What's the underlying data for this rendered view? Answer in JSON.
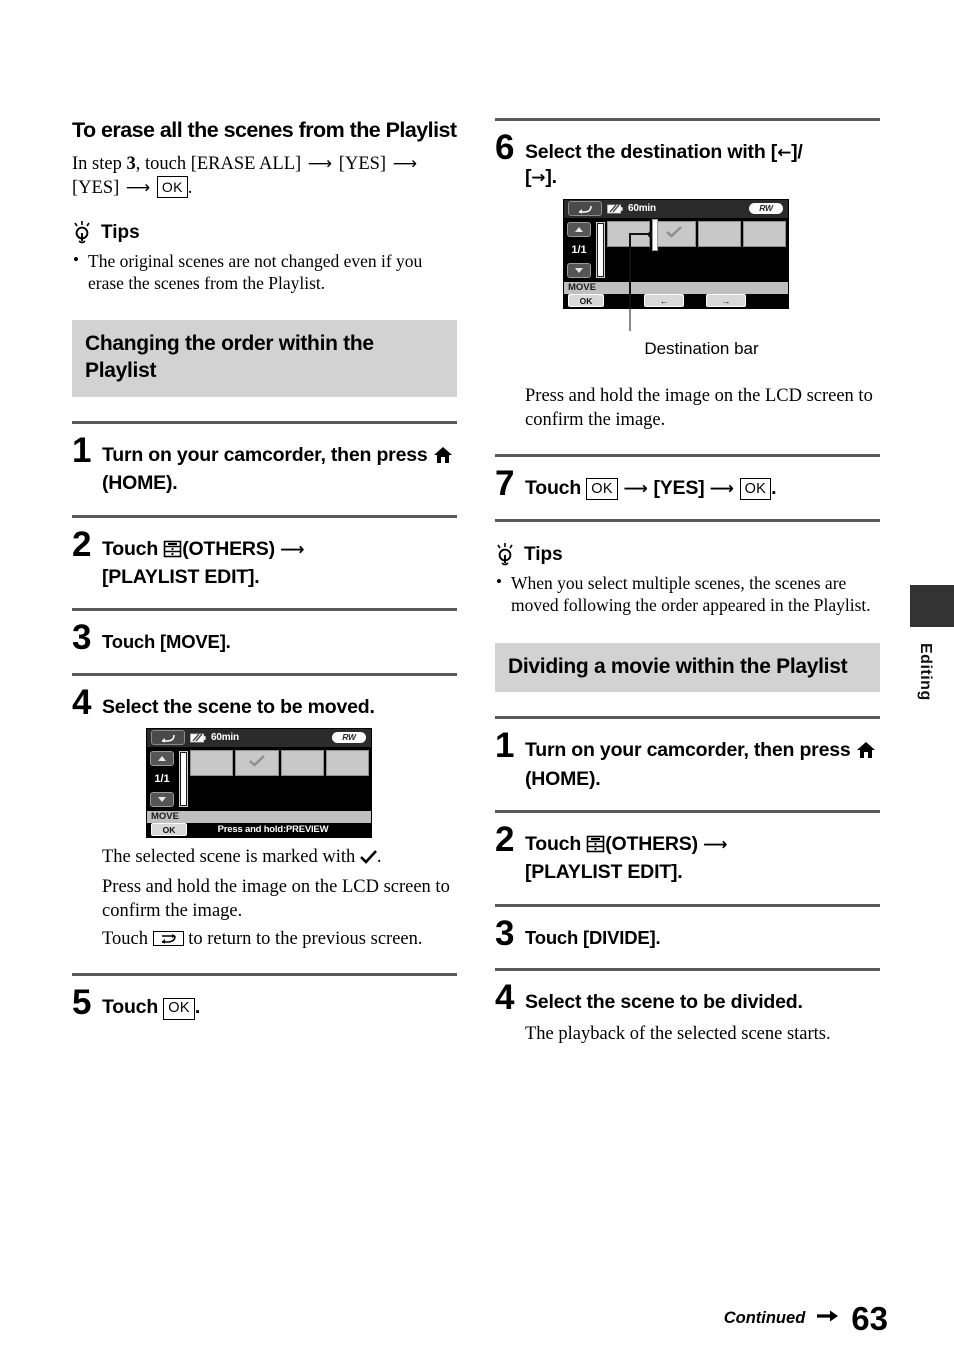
{
  "left_column": {
    "sub_heading": "To erase all the scenes from the Playlist",
    "intro": {
      "part1": "In step ",
      "step_ref": "3",
      "part2": ", touch [ERASE ALL] ",
      "yes1": "[YES] ",
      "yes2": "[YES] ",
      "ok_label": "OK",
      "period": "."
    },
    "tips_label": "Tips",
    "tips": [
      "The original scenes are not changed even if you erase the scenes from the Playlist."
    ],
    "section_title": "Changing the order within the Playlist",
    "steps": [
      {
        "num": "1",
        "text_before": "Turn on your camcorder, then press ",
        "icon": "home-icon",
        "text_after": " (HOME)."
      },
      {
        "num": "2",
        "text_before": "Touch ",
        "icon": "others-icon",
        "text_after": "(OTHERS) ",
        "text_line2": "[PLAYLIST EDIT]."
      },
      {
        "num": "3",
        "text": "Touch [MOVE]."
      },
      {
        "num": "4",
        "text": "Select the scene to be moved."
      },
      {
        "num": "5",
        "text_before": "Touch ",
        "ok_label": "OK",
        "text_after": "."
      }
    ],
    "after_figure": [
      {
        "before": "The selected scene is marked with ",
        "icon": "check-icon",
        "after": "."
      },
      {
        "text": "Press and hold the image on the LCD screen to confirm the image."
      },
      {
        "before": "Touch ",
        "icon": "return-icon",
        "after": " to return to the previous screen."
      }
    ]
  },
  "right_column": {
    "steps": [
      {
        "num": "6",
        "line1": "Select the destination with [",
        "arrow1": "←",
        "line1b": "]/",
        "line2": "[",
        "arrow2": "→",
        "line2b": "]."
      },
      {
        "num": "7",
        "text_before": "Touch ",
        "ok1": "OK",
        "mid": "[YES] ",
        "ok2": "OK",
        "text_after": "."
      },
      {
        "num": "1",
        "text_before": "Turn on your camcorder, then press ",
        "icon": "home-icon",
        "text_after": " (HOME)."
      },
      {
        "num": "2",
        "text_before": "Touch ",
        "icon": "others-icon",
        "text_after": "(OTHERS) ",
        "text_line2": "[PLAYLIST EDIT]."
      },
      {
        "num": "3",
        "text": "Touch [DIVIDE]."
      },
      {
        "num": "4",
        "text": "Select the scene to be divided."
      }
    ],
    "figure_caption": "Destination bar",
    "figure_note": "Press and hold the image on the LCD screen to confirm the image.",
    "tips_label": "Tips",
    "tips": [
      "When you select multiple scenes, the scenes are moved following the order appeared in the Playlist."
    ],
    "section_title": "Dividing a movie within the Playlist",
    "step4_note": "The playback of the selected scene starts."
  },
  "lcd_figure_1": {
    "battery_time": "60min",
    "disc_label": "RW",
    "page_indicator": "1/1",
    "mode_label": "MOVE",
    "ok_label": "OK",
    "hint": "Press and hold:PREVIEW",
    "thumb_count": 4,
    "checked_index": 1
  },
  "lcd_figure_2": {
    "battery_time": "60min",
    "disc_label": "RW",
    "page_indicator": "1/1",
    "mode_label": "MOVE",
    "ok_label": "OK",
    "prev_arrow": "←",
    "next_arrow": "→",
    "thumb_count": 4,
    "checked_index": 1
  },
  "side_tab": {
    "label": "Editing"
  },
  "footer": {
    "continued": "Continued",
    "page_number": "63"
  },
  "colors": {
    "band": "#d2d2d2",
    "rule": "#5a5a5a",
    "lcd_bg": "#000000",
    "thumb": "#c8c8c8"
  }
}
